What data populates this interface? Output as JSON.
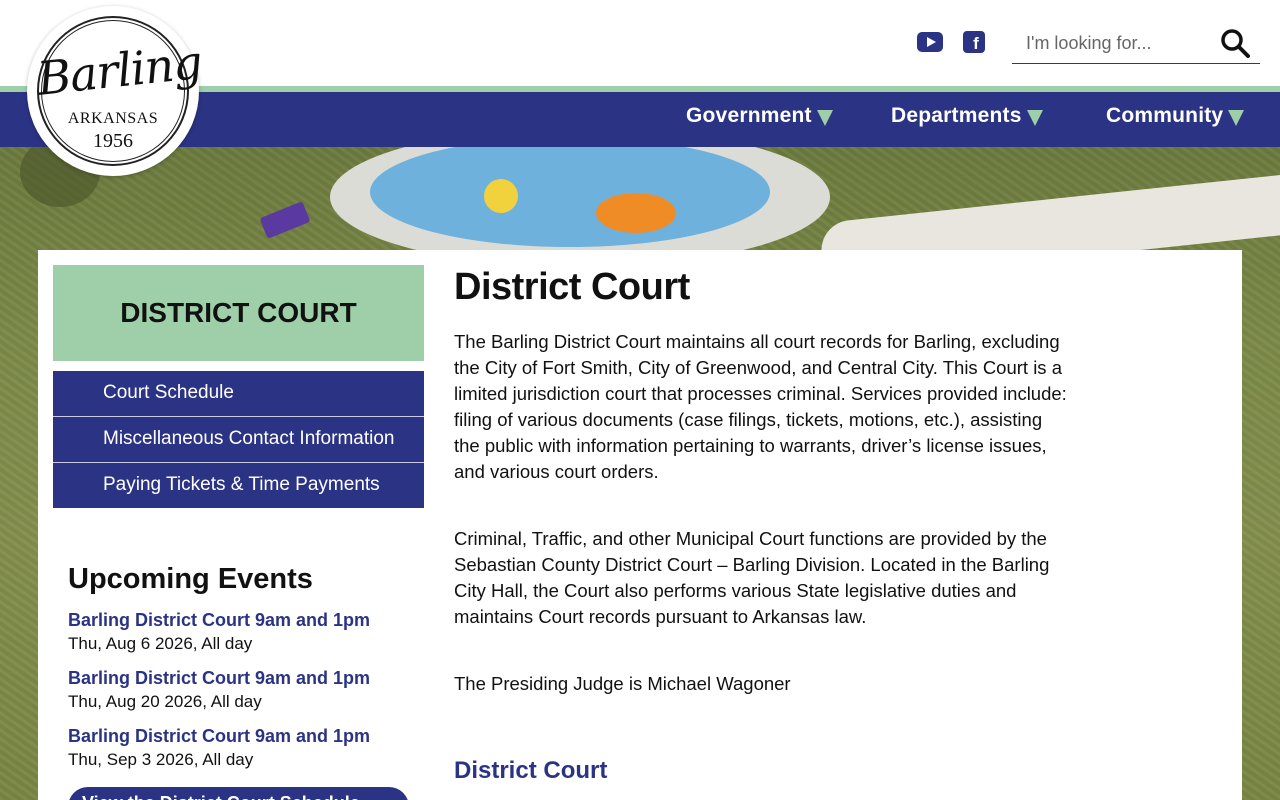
{
  "site": {
    "logo": {
      "script": "Barling",
      "state": "ARKANSAS",
      "year": "1956"
    },
    "search_placeholder": "I'm looking for...",
    "social": [
      "youtube-icon",
      "facebook-icon"
    ],
    "brand_colors": {
      "navy": "#2b3384",
      "green": "#9ecfa8"
    }
  },
  "nav": {
    "items": [
      {
        "label": "Government"
      },
      {
        "label": "Departments"
      },
      {
        "label": "Community"
      }
    ]
  },
  "sidebar": {
    "title": "DISTRICT COURT",
    "items": [
      {
        "label": "Court Schedule"
      },
      {
        "label": "Miscellaneous Contact Information"
      },
      {
        "label": "Paying Tickets & Time Payments"
      }
    ],
    "events_title": "Upcoming Events",
    "events": [
      {
        "title": "Barling District Court 9am and 1pm",
        "date": "Thu, Aug 6 2026, All day"
      },
      {
        "title": "Barling District Court 9am and 1pm",
        "date": "Thu, Aug 20 2026, All day"
      },
      {
        "title": "Barling District Court 9am and 1pm",
        "date": "Thu, Sep 3 2026, All day"
      }
    ],
    "view_button": "View the District Court Schedule"
  },
  "main": {
    "title": "District Court",
    "paragraphs": [
      "The Barling District Court maintains all court records for Barling, excluding the City of Fort Smith, City of Greenwood, and Central City.  This Court is a limited jurisdiction court that processes criminal. Services provided include:  filing of various documents (case filings, tickets, motions, etc.), assisting the public with information pertaining to warrants, driver’s license issues, and various court orders.",
      "Criminal, Traffic,  and other Municipal Court functions are provided by the Sebastian County District Court – Barling Division.  Located in the Barling City Hall, the Court also performs various State legislative duties and maintains Court records pursuant to Arkansas law.",
      "The Presiding Judge is Michael Wagoner"
    ],
    "subheading": "District Court"
  }
}
